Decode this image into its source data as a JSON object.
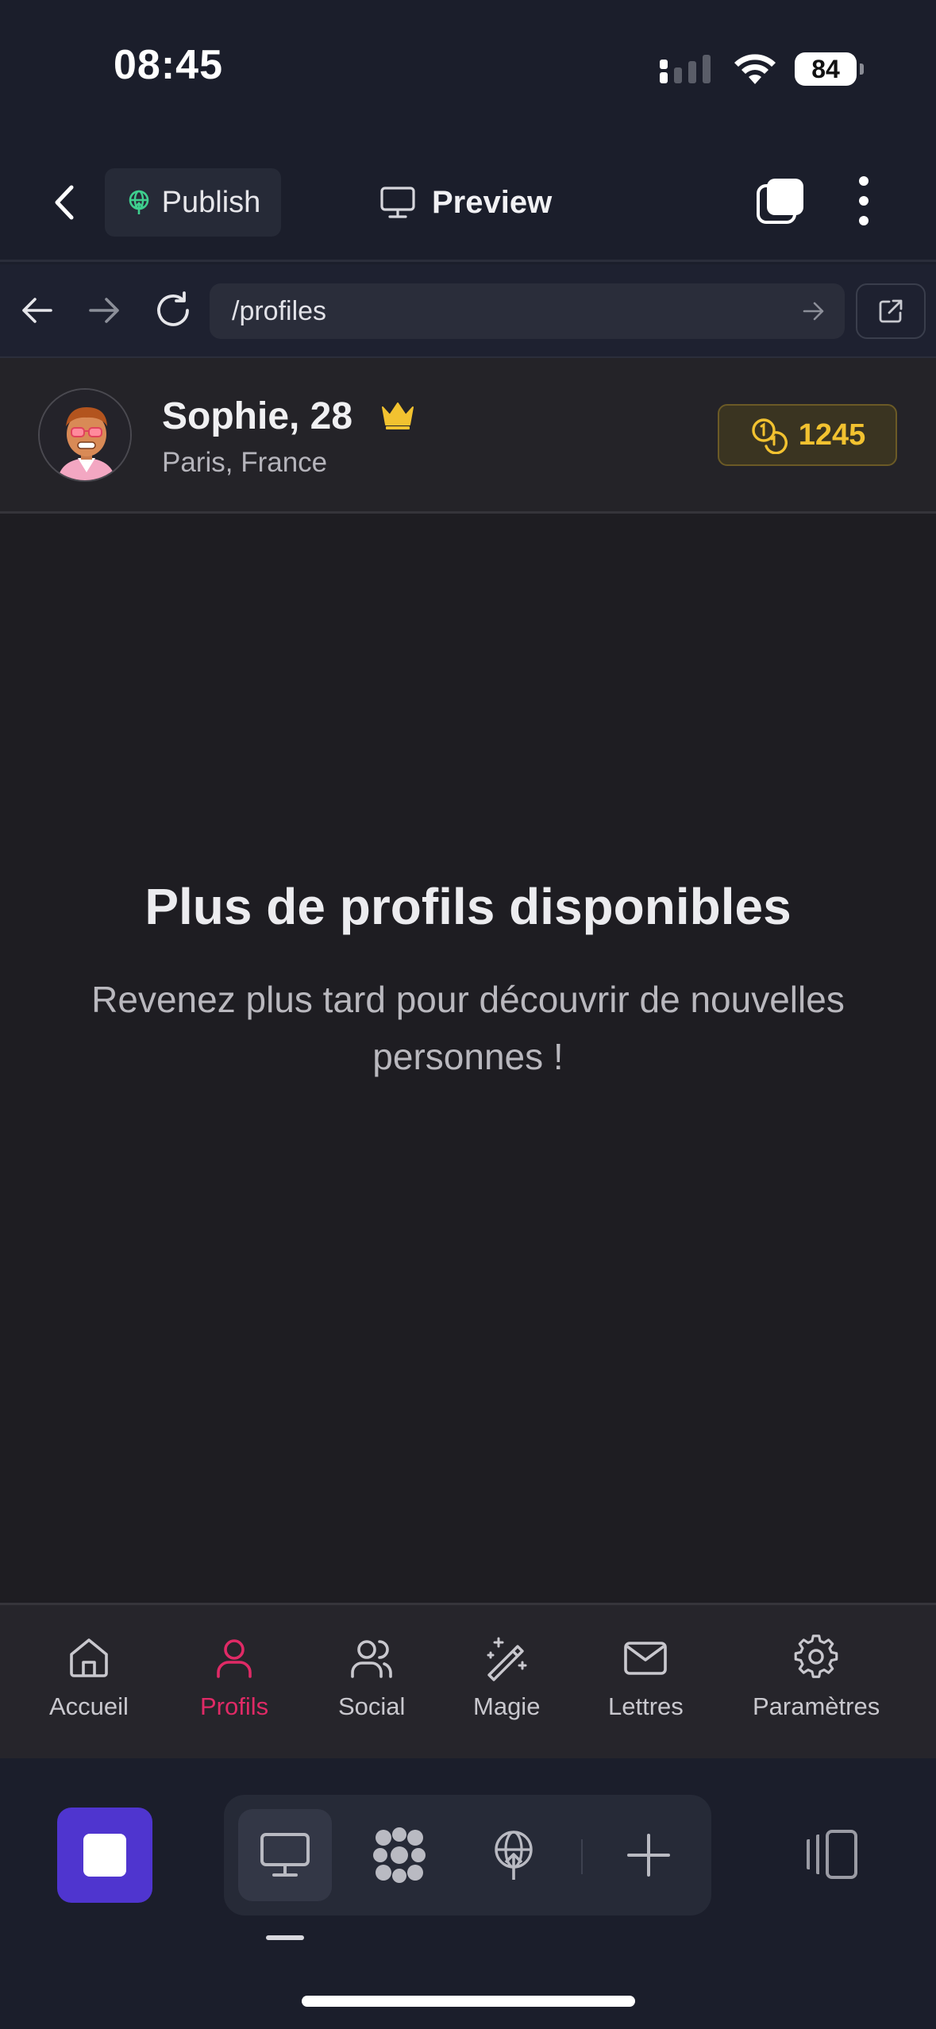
{
  "status_bar": {
    "time": "08:45",
    "battery": "84"
  },
  "topbar": {
    "publish_label": "Publish",
    "preview_label": "Preview"
  },
  "browser": {
    "url": "/profiles"
  },
  "profile": {
    "name_age": "Sophie, 28",
    "city": "Paris, France",
    "coins": "1245"
  },
  "empty_state": {
    "title": "Plus de profils disponibles",
    "subtitle": "Revenez plus tard pour découvrir de nouvelles personnes !"
  },
  "bottom_nav": {
    "items": [
      {
        "label": "Accueil",
        "icon": "home-icon"
      },
      {
        "label": "Profils",
        "icon": "user-icon",
        "active": true
      },
      {
        "label": "Social",
        "icon": "users-icon"
      },
      {
        "label": "Magie",
        "icon": "magic-wand-icon"
      },
      {
        "label": "Lettres",
        "icon": "mail-icon"
      },
      {
        "label": "Paramètres",
        "icon": "gear-icon"
      }
    ]
  },
  "colors": {
    "accent_pink": "#e02a66",
    "coin_gold": "#f2c230",
    "stop_purple": "#4f35cf",
    "publish_green": "#3ecf8e"
  }
}
